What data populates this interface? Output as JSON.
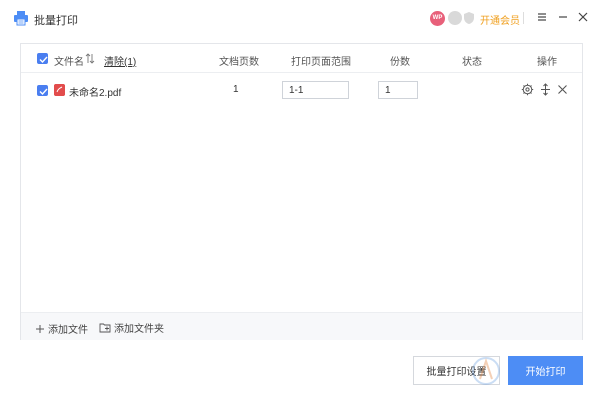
{
  "window": {
    "title": "批量打印",
    "avatar_text": "WP",
    "vip_label": "开通会员"
  },
  "table": {
    "headers": {
      "file_name": "文件名",
      "clear": "清除(1)",
      "page_count": "文档页数",
      "page_range": "打印页面范围",
      "copies": "份数",
      "status": "状态",
      "actions": "操作"
    },
    "rows": [
      {
        "file_name": "未命名2.pdf",
        "page_count": "1",
        "page_range": "1-1",
        "copies": "1",
        "status": ""
      }
    ]
  },
  "footer": {
    "add_file": "添加文件",
    "add_folder": "添加文件夹"
  },
  "buttons": {
    "print_settings": "批量打印设置",
    "start_print": "开始打印"
  },
  "colors": {
    "accent": "#4d8df5",
    "vip": "#f0a020",
    "pdf": "#e24c4c"
  },
  "icons": {
    "app": "printer-icon",
    "menu": "menu-icon",
    "minimize": "minimize-icon",
    "close": "close-icon"
  }
}
